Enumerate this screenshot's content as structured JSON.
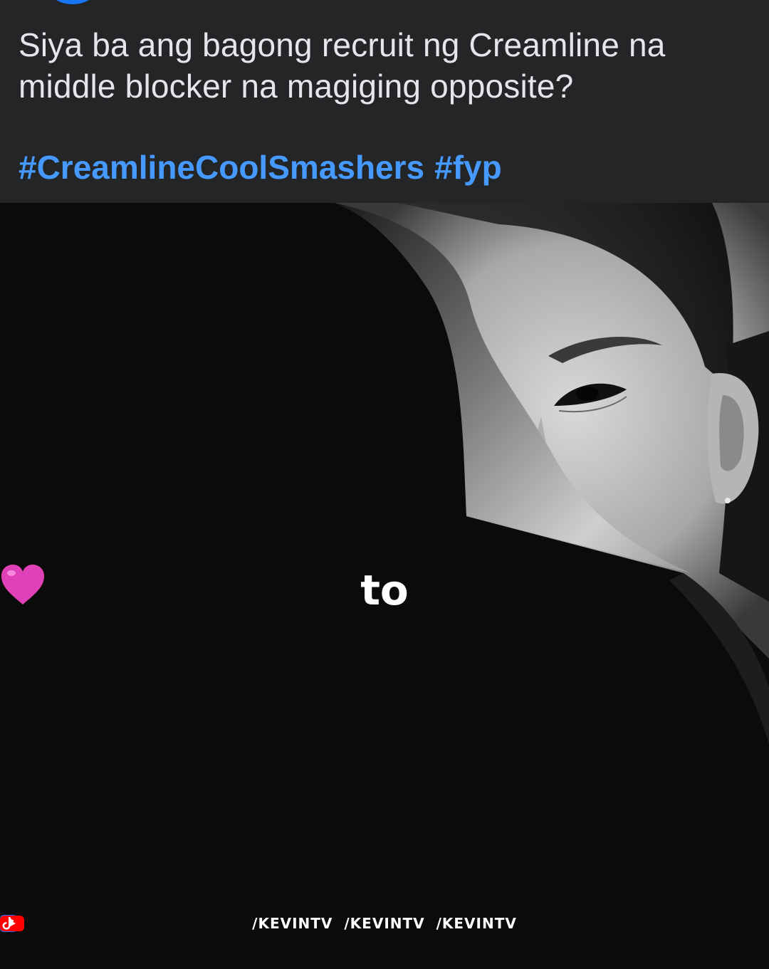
{
  "post": {
    "caption": "Siya ba ang bagong recruit ng Creamline na middle blocker na magiging opposite?",
    "hashtags": [
      "#CreamlineCoolSmashers",
      "#fyp"
    ]
  },
  "media": {
    "overlay_word": "to",
    "heart_left_color": "#e8202e",
    "heart_right_color": "#e040b8",
    "watermark": [
      {
        "platform": "facebook-icon",
        "handle": "/KEVINTV"
      },
      {
        "platform": "youtube-icon",
        "handle": "/KEVINTV"
      },
      {
        "platform": "tiktok-icon",
        "handle": "/KEVINTV"
      }
    ]
  },
  "colors": {
    "background": "#242526",
    "text": "#e4e6eb",
    "hashtag": "#4599ff",
    "facebook": "#1877f2",
    "youtube": "#ff0000"
  }
}
